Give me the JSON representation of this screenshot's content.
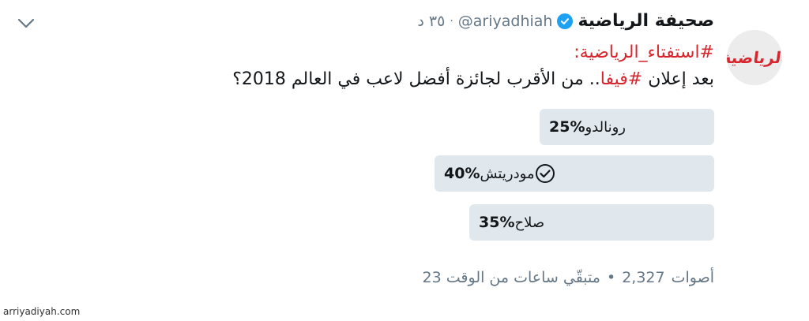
{
  "tweet": {
    "display_name": "صحيفة الرياضية",
    "handle": "@ariyadhiah",
    "separator": "·",
    "time": "٣٥ د",
    "hashtag_line": "#استفتاء_الرياضية:",
    "text_before": "بعد إعلان ",
    "hashtag_fifa": "#فيفا",
    "text_after": ".. من الأقرب لجائزة أفضل لاعب في العالم 2018؟",
    "avatar_logo": "الرياضية"
  },
  "poll": {
    "options": [
      {
        "percent": "25%",
        "label": "رونالدو",
        "value": 25,
        "selected": false
      },
      {
        "percent": "40%",
        "label": "مودريتش",
        "value": 40,
        "selected": true
      },
      {
        "percent": "35%",
        "label": "صلاح",
        "value": 35,
        "selected": false
      }
    ],
    "votes_count": "2,327",
    "votes_label": "أصوات",
    "bullet": "•",
    "remaining": "متبقّي ساعات من الوقت 23"
  },
  "icons": {
    "verified": "verified-badge-icon",
    "chevron": "chevron-down-icon",
    "check": "check-circle-icon"
  },
  "watermark": "arriyadiyah.com",
  "colors": {
    "brand_red": "#d8262f",
    "verified_blue": "#1da1f2",
    "poll_bar": "#e1e8ed",
    "muted_text": "#657786"
  }
}
